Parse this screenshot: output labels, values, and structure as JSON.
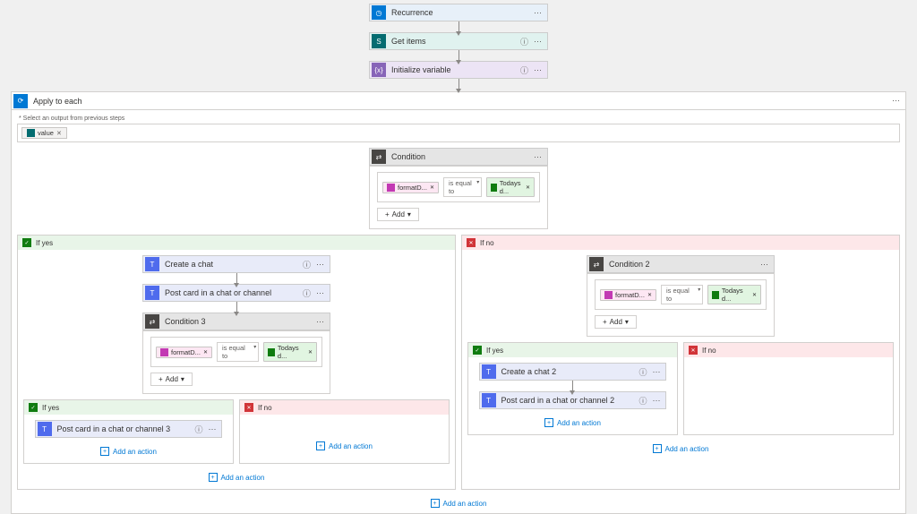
{
  "top_actions": {
    "recurrence": "Recurrence",
    "get_items": "Get items",
    "init_var": "Initialize variable"
  },
  "apply_to_each": {
    "title": "Apply to each",
    "hint": "* Select an output from previous steps",
    "token": "value"
  },
  "condition": {
    "title": "Condition",
    "left": "formatD...",
    "op": "is equal to",
    "right": "Todays d...",
    "add": "Add"
  },
  "if_yes": "If yes",
  "if_no": "If no",
  "create_chat": "Create a chat",
  "post_card": "Post card in a chat or channel",
  "condition3": {
    "title": "Condition 3",
    "left": "formatD...",
    "op": "is equal to",
    "right": "Todays d...",
    "add": "Add"
  },
  "post_card3": "Post card in a chat or channel 3",
  "condition2": {
    "title": "Condition 2",
    "left": "formatD...",
    "op": "is equal to",
    "right": "Todays d...",
    "add": "Add"
  },
  "create_chat2": "Create a chat 2",
  "post_card2": "Post card in a chat or channel 2",
  "add_action": "Add an action"
}
